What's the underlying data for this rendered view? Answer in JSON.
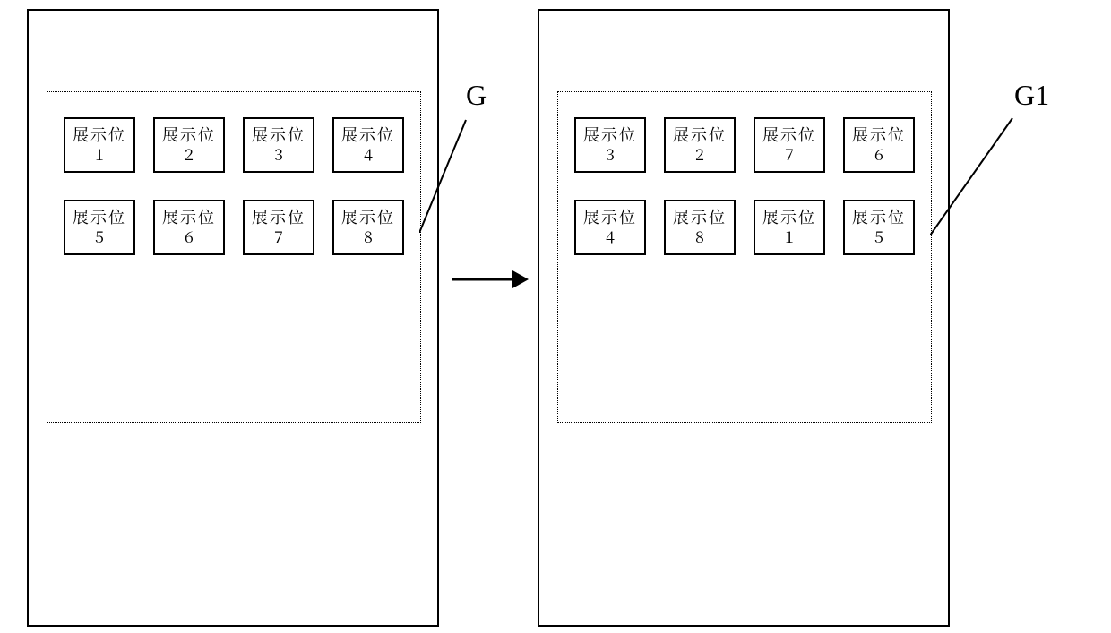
{
  "left_label": "G",
  "right_label": "G1",
  "slot_label": "展示位",
  "left": {
    "slots": [
      "1",
      "2",
      "3",
      "4",
      "5",
      "6",
      "7",
      "8"
    ]
  },
  "right": {
    "slots": [
      "3",
      "2",
      "7",
      "6",
      "4",
      "8",
      "1",
      "5"
    ]
  }
}
